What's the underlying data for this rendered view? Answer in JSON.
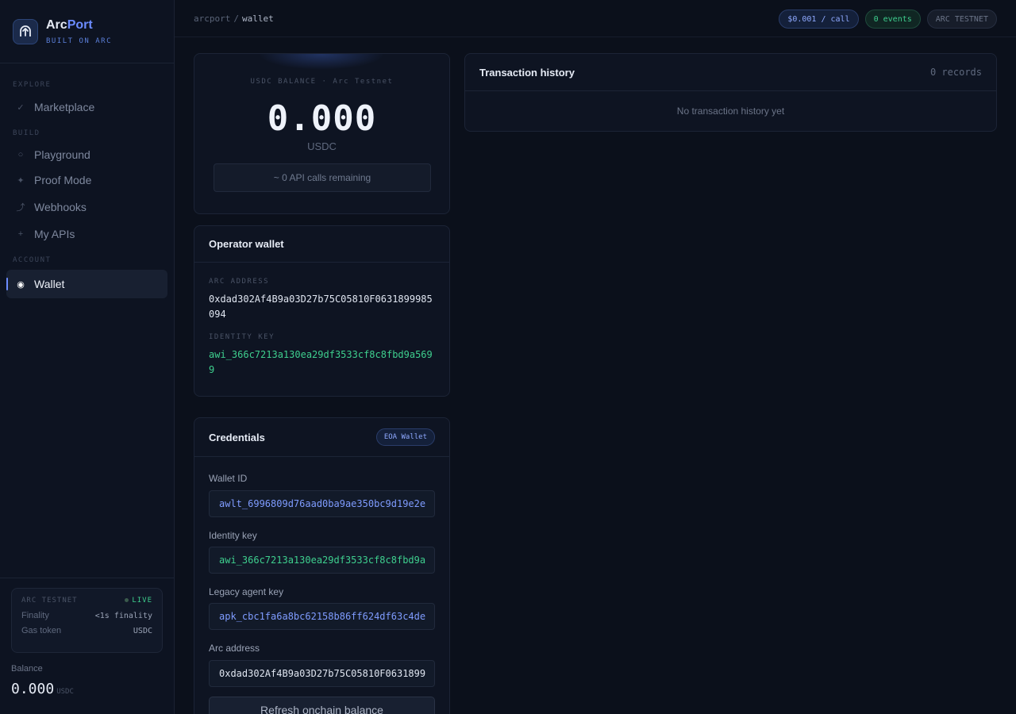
{
  "brand": {
    "name_main": "Arc",
    "name_accent": "Port",
    "subtitle": "BUILT ON ARC",
    "logo_icon": "arrow-up-arc-icon"
  },
  "sidebar": {
    "sections": {
      "explore": "EXPLORE",
      "build": "BUILD",
      "account": "ACCOUNT"
    },
    "items": [
      {
        "label": "Marketplace",
        "icon": "check-icon"
      },
      {
        "label": "Playground",
        "icon": "circle-icon"
      },
      {
        "label": "Proof Mode",
        "icon": "sparkle-icon"
      },
      {
        "label": "Webhooks",
        "icon": "curve-arrow-icon"
      },
      {
        "label": "My APIs",
        "icon": "plus-icon"
      },
      {
        "label": "Wallet",
        "icon": "radio-dot-icon",
        "active": true
      }
    ],
    "network": {
      "title": "ARC TESTNET",
      "status": "LIVE",
      "finality_label": "Finality",
      "finality_value": "<1s finality",
      "gas_label": "Gas token",
      "gas_value": "USDC"
    },
    "balance": {
      "label": "Balance",
      "value": "0.000",
      "unit": "USDC"
    }
  },
  "topbar": {
    "crumb_root": "arcport",
    "crumb_sep": "/",
    "crumb_current": "wallet",
    "price_pill": "$0.001 / call",
    "events_pill": "0 events",
    "network_pill": "ARC TESTNET"
  },
  "balance_card": {
    "caption": "USDC BALANCE · Arc Testnet",
    "amount": "0.000",
    "unit": "USDC",
    "calls_remaining": "~ 0 API calls remaining"
  },
  "wallet_card": {
    "title": "Operator wallet",
    "address_label": "ARC ADDRESS",
    "address": "0xdad302Af4B9a03D27b75C05810F0631899985094",
    "identity_label": "IDENTITY KEY",
    "identity_key": "awi_366c7213a130ea29df3533cf8c8fbd9a5699"
  },
  "credentials": {
    "title": "Credentials",
    "badge": "EOA Wallet",
    "fields": [
      {
        "label": "Wallet ID",
        "value": "awlt_6996809d76aad0ba9ae350bc9d19e2e"
      },
      {
        "label": "Identity key",
        "value": "awi_366c7213a130ea29df3533cf8c8fbd9a"
      },
      {
        "label": "Legacy agent key",
        "value": "apk_cbc1fa6a8bc62158b86ff624df63c4de"
      },
      {
        "label": "Arc address",
        "value": "0xdad302Af4B9a03D27b75C05810F0631899"
      }
    ],
    "refresh_button": "Refresh onchain balance"
  },
  "transactions": {
    "title": "Transaction history",
    "count": "0 records",
    "empty": "No transaction history yet"
  },
  "colors": {
    "accent": "#6c8cff",
    "success": "#3ecf8e",
    "background": "#0b101b"
  }
}
